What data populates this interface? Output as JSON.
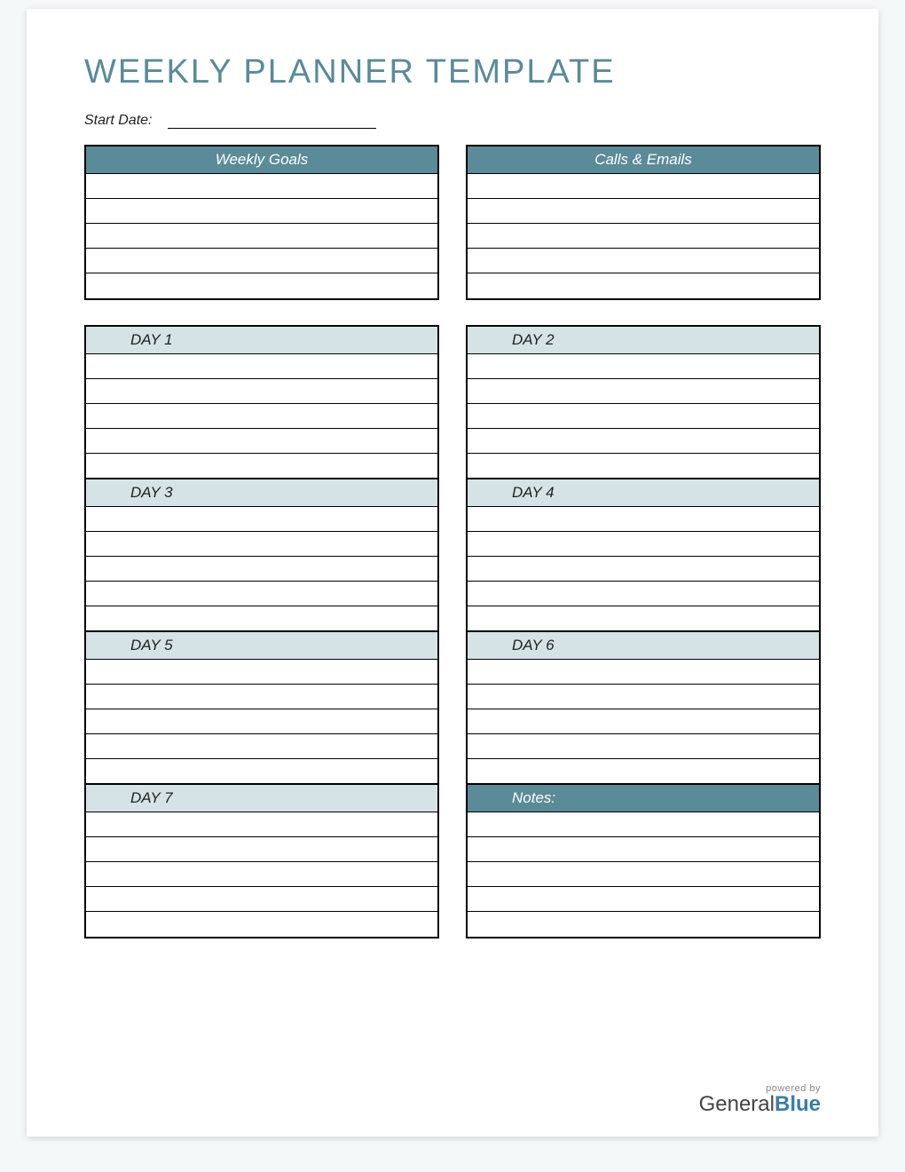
{
  "title": "WEEKLY PLANNER TEMPLATE",
  "startDateLabel": "Start Date:",
  "sections": {
    "weeklyGoals": "Weekly Goals",
    "callsEmails": "Calls & Emails",
    "notes": "Notes:"
  },
  "days": [
    "DAY 1",
    "DAY 2",
    "DAY 3",
    "DAY 4",
    "DAY 5",
    "DAY 6",
    "DAY 7"
  ],
  "footer": {
    "poweredBy": "powered by",
    "brandA": "General",
    "brandB": "Blue"
  },
  "colors": {
    "accent": "#5b8a99",
    "lightHeader": "#d6e3e6"
  }
}
